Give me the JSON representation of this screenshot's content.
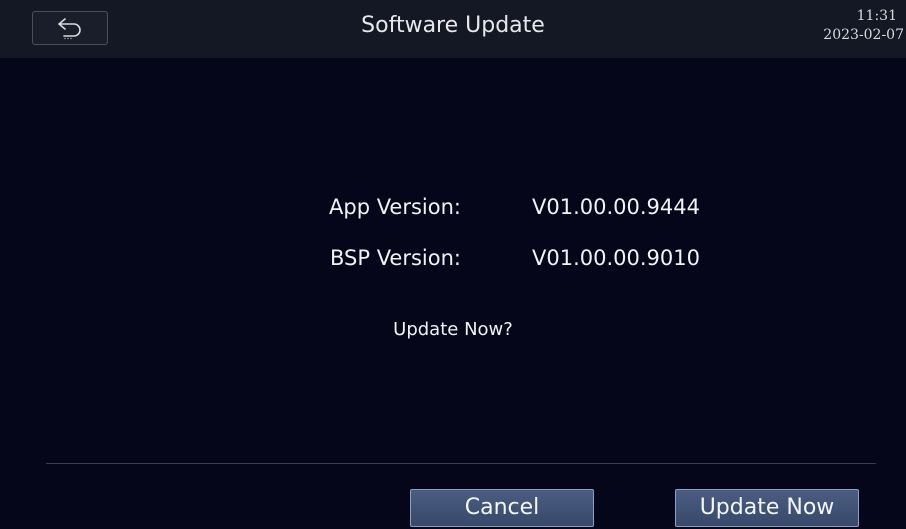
{
  "header": {
    "back_icon": "back-arrow-icon",
    "title": "Software Update",
    "time": "11:31",
    "date": "2023-02-07"
  },
  "versions": [
    {
      "label": "App Version:",
      "value": "V01.00.00.9444"
    },
    {
      "label": "BSP Version:",
      "value": "V01.00.00.9010"
    }
  ],
  "prompt": "Update Now?",
  "actions": {
    "cancel_label": "Cancel",
    "update_label": "Update Now"
  },
  "colors": {
    "background": "#06061a",
    "header_bar": "#141824",
    "button": "#4a5d80",
    "text": "#f2f2f4"
  }
}
